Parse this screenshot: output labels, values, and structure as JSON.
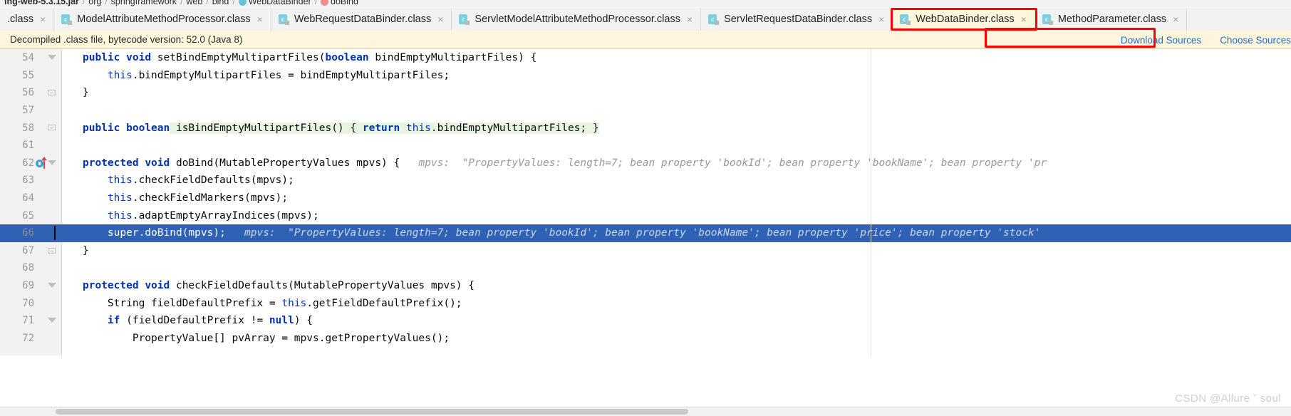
{
  "breadcrumb": {
    "items": [
      {
        "label": "ing-web-5.3.15.jar",
        "icon": "",
        "bold": true
      },
      {
        "label": "org",
        "icon": "",
        "bold": false
      },
      {
        "label": "springframework",
        "icon": "",
        "bold": false
      },
      {
        "label": "web",
        "icon": "",
        "bold": false
      },
      {
        "label": "bind",
        "icon": "",
        "bold": false
      },
      {
        "label": "WebDataBinder",
        "icon": "class-dot-icon",
        "bold": false
      },
      {
        "label": "doBind",
        "icon": "method-dot-icon",
        "bold": false
      }
    ],
    "separator": "/"
  },
  "tabs": [
    {
      "label": ".class",
      "icon": "java-class-icon",
      "active": false,
      "close": "×",
      "partial": true
    },
    {
      "label": "ModelAttributeMethodProcessor.class",
      "icon": "java-class-icon",
      "active": false,
      "close": "×"
    },
    {
      "label": "WebRequestDataBinder.class",
      "icon": "java-class-icon",
      "active": false,
      "close": "×"
    },
    {
      "label": "ServletModelAttributeMethodProcessor.class",
      "icon": "java-class-icon",
      "active": false,
      "close": "×"
    },
    {
      "label": "ServletRequestDataBinder.class",
      "icon": "java-class-icon",
      "active": false,
      "close": "×"
    },
    {
      "label": "WebDataBinder.class",
      "icon": "java-class-icon",
      "active": true,
      "close": "×"
    },
    {
      "label": "MethodParameter.class",
      "icon": "java-class-icon",
      "active": false,
      "close": "×"
    }
  ],
  "tab_icon_letter": "c",
  "notification": {
    "message": "Decompiled .class file, bytecode version: 52.0 (Java 8)",
    "download_sources": "Download Sources",
    "choose_sources": "Choose Sources"
  },
  "colors": {
    "accent_red": "#ff0000",
    "selection_blue": "#2f62b4",
    "banner_yellow": "#fdf6dd",
    "link_blue": "#2a6dbd",
    "keyword_blue": "#0033b3",
    "hint_gray": "#9a9a9a",
    "class_icon_blue": "#7ecfe0",
    "method_dot_pink": "#f08b8b"
  },
  "code": {
    "lines": [
      {
        "num": "54",
        "selected": false,
        "fold": "tri",
        "segments": [
          {
            "t": "public",
            "c": "kw"
          },
          {
            "t": " ",
            "c": ""
          },
          {
            "t": "void",
            "c": "kw"
          },
          {
            "t": " setBindEmptyMultipartFiles(",
            "c": ""
          },
          {
            "t": "boolean",
            "c": "kw"
          },
          {
            "t": " bindEmptyMultipartFiles) {",
            "c": ""
          }
        ]
      },
      {
        "num": "55",
        "selected": false,
        "fold": "",
        "segments": [
          {
            "t": "    ",
            "c": ""
          },
          {
            "t": "this",
            "c": "this"
          },
          {
            "t": ".bindEmptyMultipartFiles = bindEmptyMultipartFiles;",
            "c": ""
          }
        ]
      },
      {
        "num": "56",
        "selected": false,
        "fold": "box",
        "segments": [
          {
            "t": "}",
            "c": ""
          }
        ]
      },
      {
        "num": "57",
        "selected": false,
        "fold": "",
        "segments": []
      },
      {
        "num": "58",
        "selected": false,
        "fold": "box",
        "segments": [
          {
            "t": "public",
            "c": "kw"
          },
          {
            "t": " ",
            "c": ""
          },
          {
            "t": "boolean",
            "c": "kw"
          },
          {
            "t": " isBindEmptyMultipartFiles() { ",
            "c": "hl-green"
          },
          {
            "t": "return",
            "c": "kw hl-green"
          },
          {
            "t": " ",
            "c": "hl-green"
          },
          {
            "t": "this",
            "c": "this hl-green"
          },
          {
            "t": ".bindEmptyMultipartFiles; }",
            "c": "hl-green"
          }
        ]
      },
      {
        "num": "61",
        "selected": false,
        "fold": "",
        "segments": []
      },
      {
        "num": "62",
        "selected": false,
        "fold": "tri",
        "breakpoint": true,
        "segments": [
          {
            "t": "protected",
            "c": "kw"
          },
          {
            "t": " ",
            "c": ""
          },
          {
            "t": "void",
            "c": "kw"
          },
          {
            "t": " doBind(MutablePropertyValues mpvs) {",
            "c": ""
          },
          {
            "t": "   mpvs:  \"PropertyValues: length=7; bean property 'bookId'; bean property 'bookName'; bean property 'pr",
            "c": "hint"
          }
        ]
      },
      {
        "num": "63",
        "selected": false,
        "fold": "",
        "segments": [
          {
            "t": "    ",
            "c": ""
          },
          {
            "t": "this",
            "c": "this"
          },
          {
            "t": ".checkFieldDefaults(mpvs);",
            "c": ""
          }
        ]
      },
      {
        "num": "64",
        "selected": false,
        "fold": "",
        "segments": [
          {
            "t": "    ",
            "c": ""
          },
          {
            "t": "this",
            "c": "this"
          },
          {
            "t": ".checkFieldMarkers(mpvs);",
            "c": ""
          }
        ]
      },
      {
        "num": "65",
        "selected": false,
        "fold": "",
        "segments": [
          {
            "t": "    ",
            "c": ""
          },
          {
            "t": "this",
            "c": "this"
          },
          {
            "t": ".adaptEmptyArrayIndices(mpvs);",
            "c": ""
          }
        ]
      },
      {
        "num": "66",
        "selected": true,
        "fold": "",
        "segments": [
          {
            "t": "    super.doBind(mpvs);",
            "c": ""
          },
          {
            "t": "   mpvs:  \"PropertyValues: length=7; bean property 'bookId'; bean property 'bookName'; bean property 'price'; bean property 'stock'",
            "c": "hint"
          }
        ]
      },
      {
        "num": "67",
        "selected": false,
        "fold": "box",
        "segments": [
          {
            "t": "}",
            "c": ""
          }
        ]
      },
      {
        "num": "68",
        "selected": false,
        "fold": "",
        "segments": []
      },
      {
        "num": "69",
        "selected": false,
        "fold": "tri",
        "segments": [
          {
            "t": "protected",
            "c": "kw"
          },
          {
            "t": " ",
            "c": ""
          },
          {
            "t": "void",
            "c": "kw"
          },
          {
            "t": " checkFieldDefaults(MutablePropertyValues mpvs) {",
            "c": ""
          }
        ]
      },
      {
        "num": "70",
        "selected": false,
        "fold": "",
        "segments": [
          {
            "t": "    String fieldDefaultPrefix = ",
            "c": ""
          },
          {
            "t": "this",
            "c": "this"
          },
          {
            "t": ".getFieldDefaultPrefix();",
            "c": ""
          }
        ]
      },
      {
        "num": "71",
        "selected": false,
        "fold": "tri",
        "segments": [
          {
            "t": "    ",
            "c": ""
          },
          {
            "t": "if",
            "c": "kw"
          },
          {
            "t": " (fieldDefaultPrefix != ",
            "c": ""
          },
          {
            "t": "null",
            "c": "kw"
          },
          {
            "t": ") {",
            "c": ""
          }
        ]
      },
      {
        "num": "72",
        "selected": false,
        "fold": "",
        "segments": [
          {
            "t": "        PropertyValue[] pvArray = mpvs.getPropertyValues();",
            "c": ""
          }
        ]
      }
    ]
  },
  "watermark": "CSDN @Allure ˇ soul"
}
